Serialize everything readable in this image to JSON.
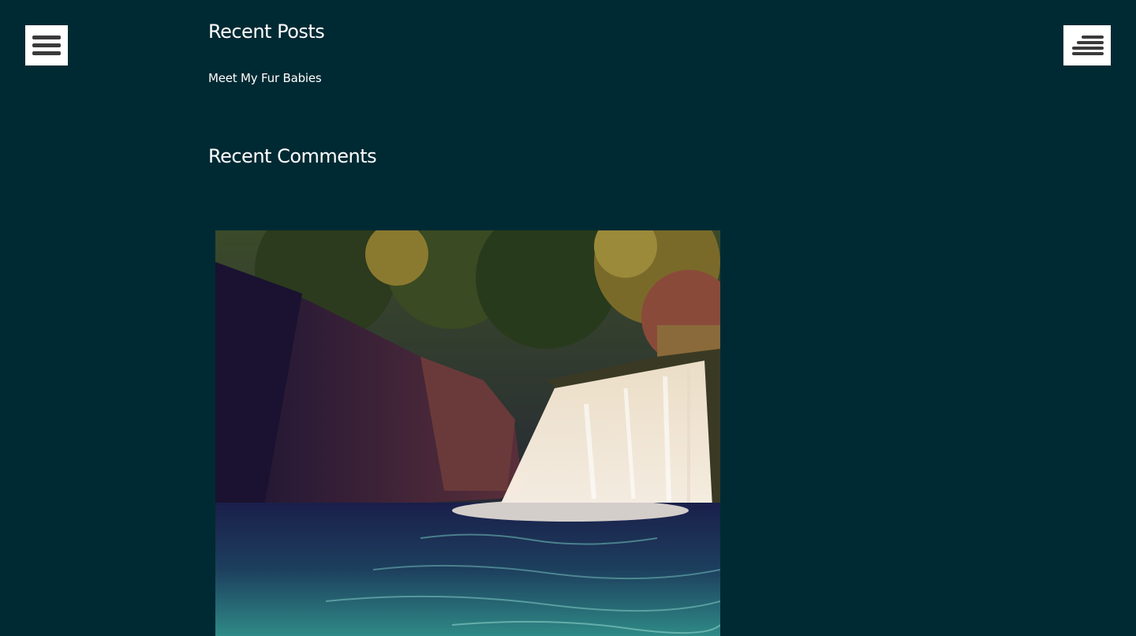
{
  "menus": {
    "left": {
      "icon": "hamburger-menu-icon"
    },
    "right": {
      "icon": "hamburger-menu-icon"
    }
  },
  "recent_posts": {
    "title": "Recent Posts",
    "items": [
      {
        "label": "Meet My Fur Babies"
      }
    ]
  },
  "recent_comments": {
    "title": "Recent Comments"
  },
  "image": {
    "subject": "waterfall-photo"
  },
  "colors": {
    "background": "#002a33",
    "text": "#ffffff",
    "menu_button": "#ffffff",
    "menu_bars": "#3a3a3a"
  }
}
